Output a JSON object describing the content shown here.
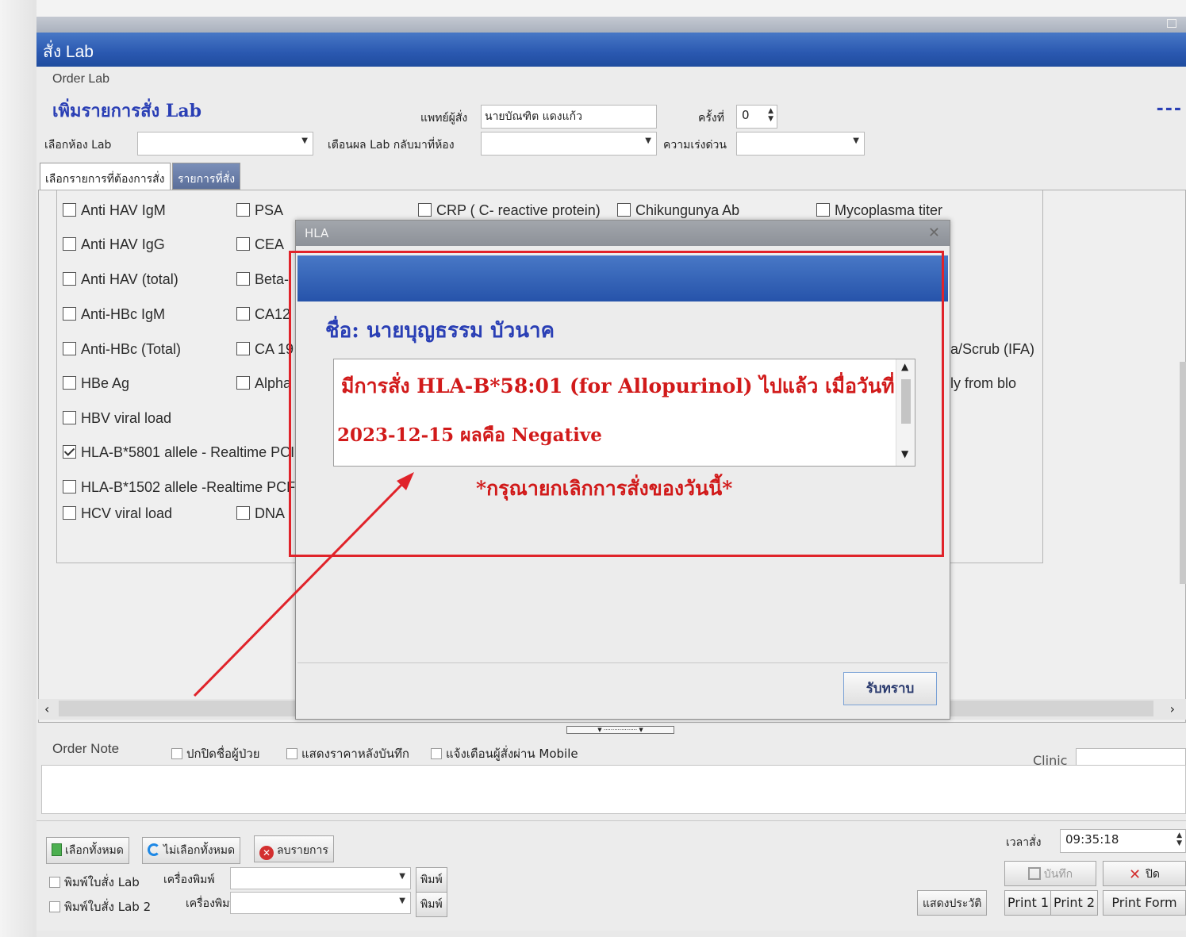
{
  "window": {
    "title": "สั่ง Lab",
    "subheader": "Order Lab",
    "headline": "เพิ่มรายการสั่ง Lab"
  },
  "form": {
    "doctor_label": "แพทย์ผู้สั่ง",
    "doctor_value": "นายบัณฑิต แดงแก้ว",
    "visit_no_label": "ครั้งที่",
    "visit_no_value": "0",
    "lab_room_label": "เลือกห้อง Lab",
    "lab_room_value": "",
    "notify_label": "เตือนผล Lab กลับมาที่ห้อง",
    "notify_value": "",
    "urgency_label": "ความเร่งด่วน",
    "urgency_value": "",
    "right_dashes": "---"
  },
  "tabs": [
    {
      "label": "เลือกรายการที่ต้องการสั่ง",
      "active": true
    },
    {
      "label": "รายการที่สั่ง",
      "active": false
    }
  ],
  "lab_items": {
    "col1": [
      {
        "label": "Anti HAV IgM",
        "checked": false
      },
      {
        "label": "Anti HAV IgG",
        "checked": false
      },
      {
        "label": "Anti HAV (total)",
        "checked": false
      },
      {
        "label": "Anti-HBc IgM",
        "checked": false
      },
      {
        "label": "Anti-HBc (Total)",
        "checked": false
      },
      {
        "label": "HBe Ag",
        "checked": false
      },
      {
        "label": "HBV viral load",
        "checked": false
      },
      {
        "label": "HLA-B*5801 allele - Realtime PCI",
        "checked": true
      },
      {
        "label": "HLA-B*1502 allele -Realtime PCF",
        "checked": false
      },
      {
        "label": "HCV viral load",
        "checked": false
      }
    ],
    "col2": [
      {
        "label": "PSA",
        "checked": false
      },
      {
        "label": "CEA",
        "checked": false
      },
      {
        "label": "Beta-",
        "checked": false
      },
      {
        "label": "CA12",
        "checked": false
      },
      {
        "label": "CA 19",
        "checked": false
      },
      {
        "label": "Alpha",
        "checked": false
      },
      {
        "label": "DNA",
        "checked": false
      }
    ],
    "top_row": [
      {
        "label": "CRP ( C- reactive protein)",
        "checked": false
      },
      {
        "label": "Chikungunya Ab",
        "checked": false
      },
      {
        "label": "Mycoplasma  titer",
        "checked": false
      }
    ],
    "right_fragments": [
      "a/Scrub (IFA)",
      "ly from blo"
    ]
  },
  "order_note": {
    "label": "Order Note",
    "hide_patient_name": "ปกปิดชื่อผู้ป่วย",
    "show_price": "แสดงราคาหลังบันทึก",
    "notify_mobile": "แจ้งเตือนผู้สั่งผ่าน Mobile",
    "clinic_label": "Clinic"
  },
  "bottom": {
    "select_all": "เลือกทั้งหมด",
    "deselect_all": "ไม่เลือกทั้งหมด",
    "delete_items": "ลบรายการ",
    "print_lab_label": "พิมพ์ใบสั่ง Lab",
    "print_lab2_label": "พิมพ์ใบสั่ง Lab 2",
    "printer_label": "เครื่องพิมพ์",
    "print_button": "พิมพ์",
    "order_time_label": "เวลาสั่ง",
    "order_time_value": "09:35:18",
    "save": "บันทึก",
    "close": "ปิด",
    "history": "แสดงประวัติ",
    "print1": "Print 1",
    "print2": "Print 2",
    "print_form": "Print Form"
  },
  "modal": {
    "title": "HLA",
    "patient": "ชื่อ: นายบุญธรรม  บัวนาค",
    "message_line1": "มีการสั่ง HLA-B*58:01 (for Allopurinol) ไปแล้ว เมื่อวันที่",
    "message_line2": "2023-12-15  ผลคือ Negative",
    "warning": "*กรุณายกเลิกการสั่งของวันนี้*",
    "ack_button": "รับทราบ"
  },
  "colors": {
    "title_blue": "#2a58b0",
    "headline_blue": "#2a3fb5",
    "alert_red": "#d11a1a",
    "annotation_red": "#e0232a"
  }
}
